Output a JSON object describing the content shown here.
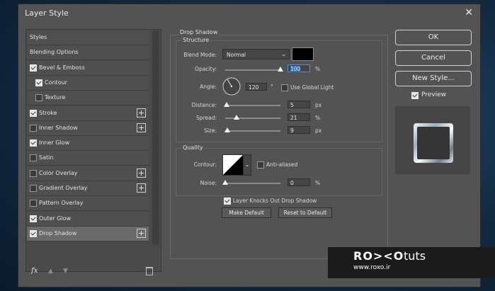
{
  "window": {
    "title": "Layer Style",
    "close_glyph": "✕"
  },
  "styles_list": [
    {
      "label": "Styles",
      "checkbox": false,
      "checked": false,
      "indent": 0,
      "plus": false,
      "selected": false
    },
    {
      "label": "Blending Options",
      "checkbox": false,
      "checked": false,
      "indent": 0,
      "plus": false,
      "selected": false
    },
    {
      "label": "Bevel & Emboss",
      "checkbox": true,
      "checked": true,
      "indent": 0,
      "plus": false,
      "selected": false
    },
    {
      "label": "Contour",
      "checkbox": true,
      "checked": true,
      "indent": 1,
      "plus": false,
      "selected": false
    },
    {
      "label": "Texture",
      "checkbox": true,
      "checked": false,
      "indent": 1,
      "plus": false,
      "selected": false
    },
    {
      "label": "Stroke",
      "checkbox": true,
      "checked": true,
      "indent": 0,
      "plus": true,
      "selected": false
    },
    {
      "label": "Inner Shadow",
      "checkbox": true,
      "checked": false,
      "indent": 0,
      "plus": true,
      "selected": false
    },
    {
      "label": "Inner Glow",
      "checkbox": true,
      "checked": true,
      "indent": 0,
      "plus": false,
      "selected": false
    },
    {
      "label": "Satin",
      "checkbox": true,
      "checked": false,
      "indent": 0,
      "plus": false,
      "selected": false
    },
    {
      "label": "Color Overlay",
      "checkbox": true,
      "checked": false,
      "indent": 0,
      "plus": true,
      "selected": false
    },
    {
      "label": "Gradient Overlay",
      "checkbox": true,
      "checked": false,
      "indent": 0,
      "plus": true,
      "selected": false
    },
    {
      "label": "Pattern Overlay",
      "checkbox": true,
      "checked": false,
      "indent": 0,
      "plus": false,
      "selected": false
    },
    {
      "label": "Outer Glow",
      "checkbox": true,
      "checked": true,
      "indent": 0,
      "plus": false,
      "selected": false
    },
    {
      "label": "Drop Shadow",
      "checkbox": true,
      "checked": true,
      "indent": 0,
      "plus": true,
      "selected": true
    }
  ],
  "footer": {
    "fx": "fx"
  },
  "drop_shadow": {
    "title": "Drop Shadow",
    "structure_title": "Structure",
    "blend_mode_label": "Blend Mode:",
    "blend_mode_value": "Normal",
    "shadow_color": "#000000",
    "opacity_label": "Opacity:",
    "opacity_value": "100",
    "opacity_unit": "%",
    "opacity_level": 1.0,
    "angle_label": "Angle:",
    "angle_value": "120",
    "angle_unit": "°",
    "use_global_light_label": "Use Global Light",
    "use_global_light": false,
    "distance_label": "Distance:",
    "distance_value": "5",
    "distance_unit": "px",
    "distance_level": 0.02,
    "spread_label": "Spread:",
    "spread_value": "21",
    "spread_unit": "%",
    "spread_level": 0.21,
    "size_label": "Size:",
    "size_value": "9",
    "size_unit": "px",
    "size_level": 0.04,
    "quality_title": "Quality",
    "contour_label": "Contour:",
    "anti_aliased_label": "Anti-aliased",
    "anti_aliased": false,
    "noise_label": "Noise:",
    "noise_value": "0",
    "noise_unit": "%",
    "noise_level": 0.0,
    "knockout_label": "Layer Knocks Out Drop Shadow",
    "knockout": true,
    "make_default_label": "Make Default",
    "reset_default_label": "Reset to Default"
  },
  "buttons": {
    "ok": "OK",
    "cancel": "Cancel",
    "new_style": "New Style..."
  },
  "preview": {
    "label": "Preview",
    "checked": true
  },
  "watermark": {
    "logo": "RO><O",
    "suffix": "tuts",
    "url": "www.roxo.ir"
  }
}
